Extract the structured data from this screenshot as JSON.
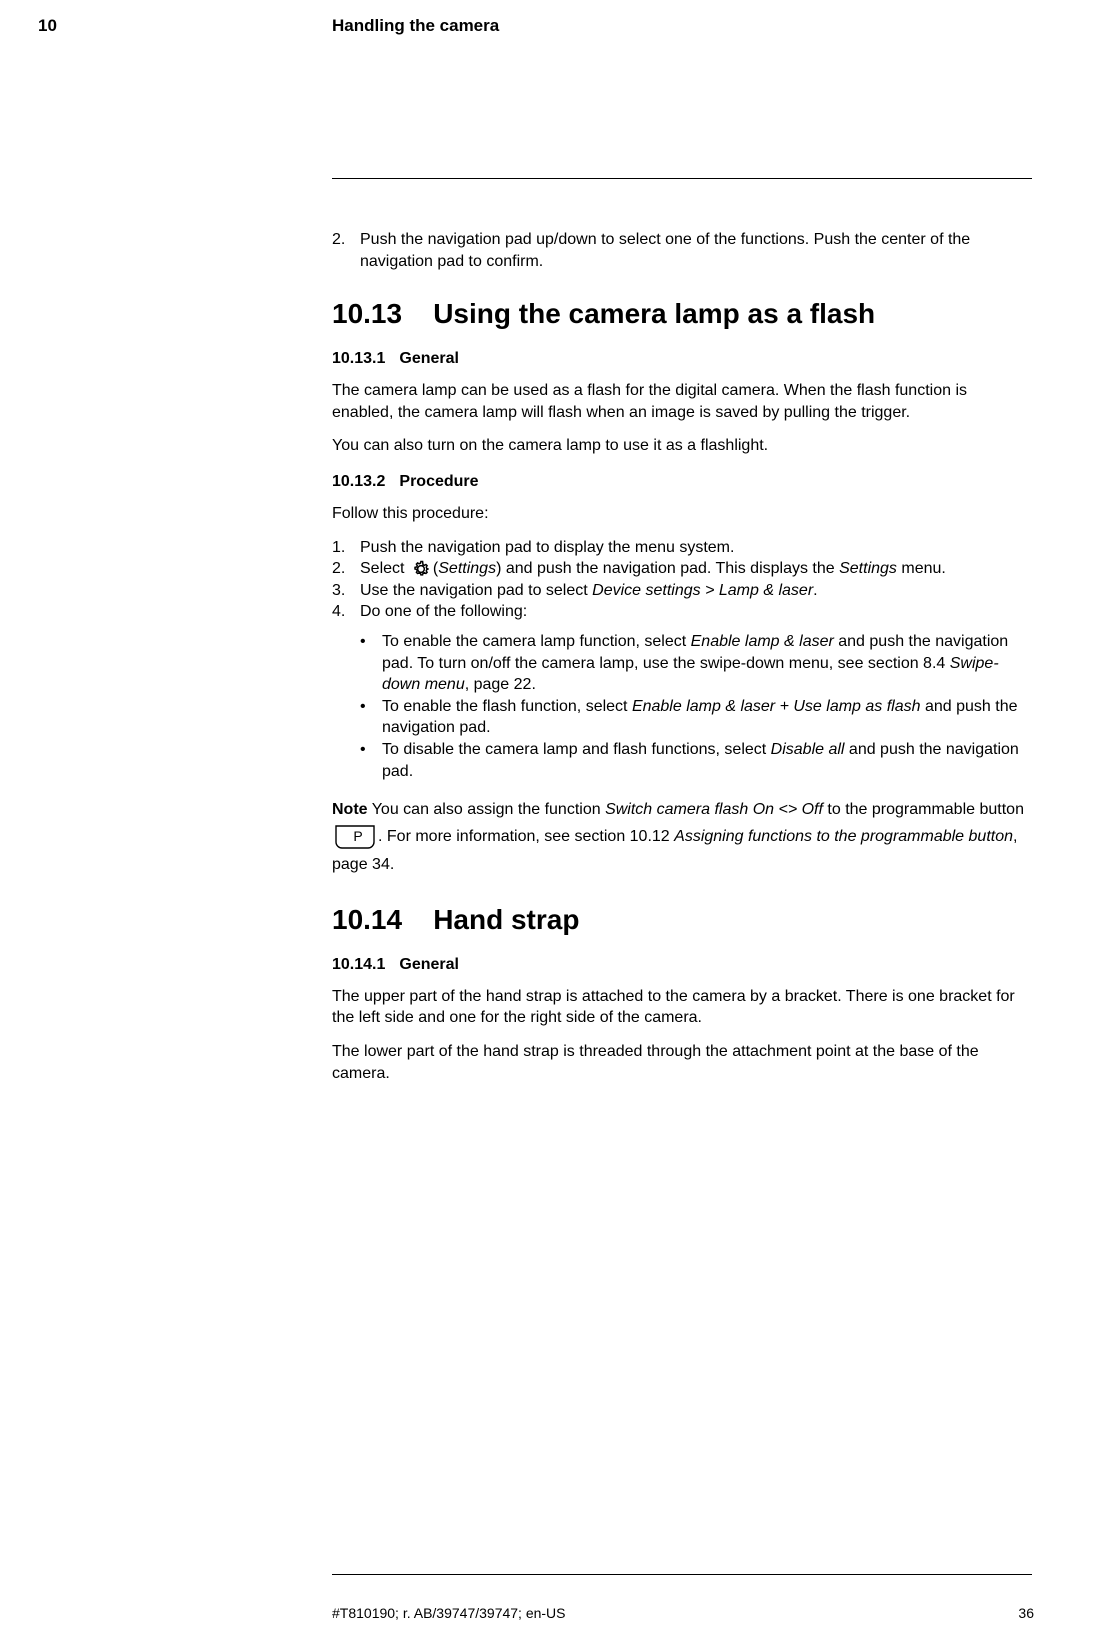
{
  "header": {
    "chapter_num": "10",
    "chapter_title": "Handling the camera"
  },
  "intro": {
    "item2_num": "2.",
    "item2_text": "Push the navigation pad up/down to select one of the functions. Push the center of the navigation pad to confirm."
  },
  "sec_10_13": {
    "number": "10.13",
    "title": "Using the camera lamp as a flash",
    "sub1_num": "10.13.1",
    "sub1_title": "General",
    "sub1_p1": "The camera lamp can be used as a flash for the digital camera. When the flash function is enabled, the camera lamp will flash when an image is saved by pulling the trigger.",
    "sub1_p2": "You can also turn on the camera lamp to use it as a flashlight.",
    "sub2_num": "10.13.2",
    "sub2_title": "Procedure",
    "sub2_lead": "Follow this procedure:",
    "step1_num": "1.",
    "step1_text": "Push the navigation pad to display the menu system.",
    "step2_num": "2.",
    "step2_pre": "Select ",
    "step2_paren_open": "(",
    "step2_settings": "Settings",
    "step2_mid": ") and push the navigation pad. This displays the ",
    "step2_settings2": "Settings",
    "step2_post": " menu.",
    "step3_num": "3.",
    "step3_pre": "Use the navigation pad to select ",
    "step3_path": "Device settings > Lamp & laser",
    "step3_post": ".",
    "step4_num": "4.",
    "step4_text": "Do one of the following:",
    "b1_pre": "To enable the camera lamp function, select ",
    "b1_em": "Enable lamp & laser",
    "b1_mid": " and push the navigation pad. To turn on/off the camera lamp, use the swipe-down menu, see section 8.4 ",
    "b1_em2": "Swipe-down menu",
    "b1_post": ", page 22.",
    "b2_pre": "To enable the flash function, select ",
    "b2_em": "Enable lamp & laser + Use lamp as flash",
    "b2_post": " and push the navigation pad.",
    "b3_pre": "To disable the camera lamp and flash functions, select ",
    "b3_em": "Disable all",
    "b3_post": " and push the navigation pad.",
    "note_label": "Note",
    "note_pre": "    You can also assign the function ",
    "note_em": "Switch camera flash On <> Off",
    "note_mid": " to the programmable button ",
    "note_mid2": ". For more information, see section 10.12 ",
    "note_em2": "Assigning functions to the programmable button",
    "note_post": ", page 34.",
    "bullet": "•"
  },
  "sec_10_14": {
    "number": "10.14",
    "title": "Hand strap",
    "sub1_num": "10.14.1",
    "sub1_title": "General",
    "sub1_p1": "The upper part of the hand strap is attached to the camera by a bracket. There is one bracket for the left side and one for the right side of the camera.",
    "sub1_p2": "The lower part of the hand strap is threaded through the attachment point at the base of the camera."
  },
  "footer": {
    "left": "#T810190; r. AB/39747/39747; en-US",
    "right": "36"
  }
}
